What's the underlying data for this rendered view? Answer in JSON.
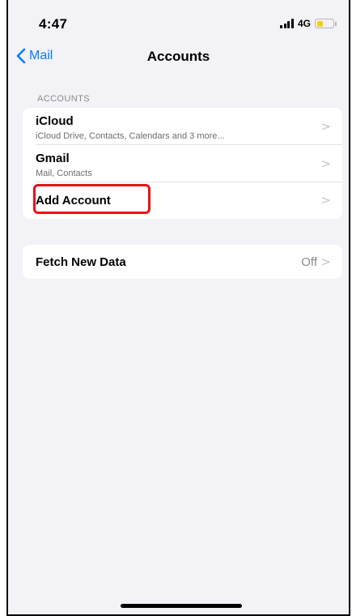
{
  "status_bar": {
    "time": "4:47",
    "network": "4G",
    "signal_icon": "signal-bars-icon",
    "battery_icon": "battery-icon",
    "battery_level": 0.4,
    "battery_color": "#f5d10a"
  },
  "nav": {
    "back_label": "Mail",
    "back_icon": "chevron-left-icon",
    "title": "Accounts"
  },
  "accounts_section": {
    "header": "ACCOUNTS",
    "items": [
      {
        "title": "iCloud",
        "subtitle": "iCloud Drive, Contacts, Calendars and 3 more..."
      },
      {
        "title": "Gmail",
        "subtitle": "Mail, Contacts"
      },
      {
        "title": "Add Account"
      }
    ]
  },
  "fetch_section": {
    "title": "Fetch New Data",
    "value": "Off"
  },
  "chevron_glyph": ">",
  "colors": {
    "accent": "#0a7aff",
    "highlight": "#e8101a",
    "background": "#f2f2f7"
  }
}
